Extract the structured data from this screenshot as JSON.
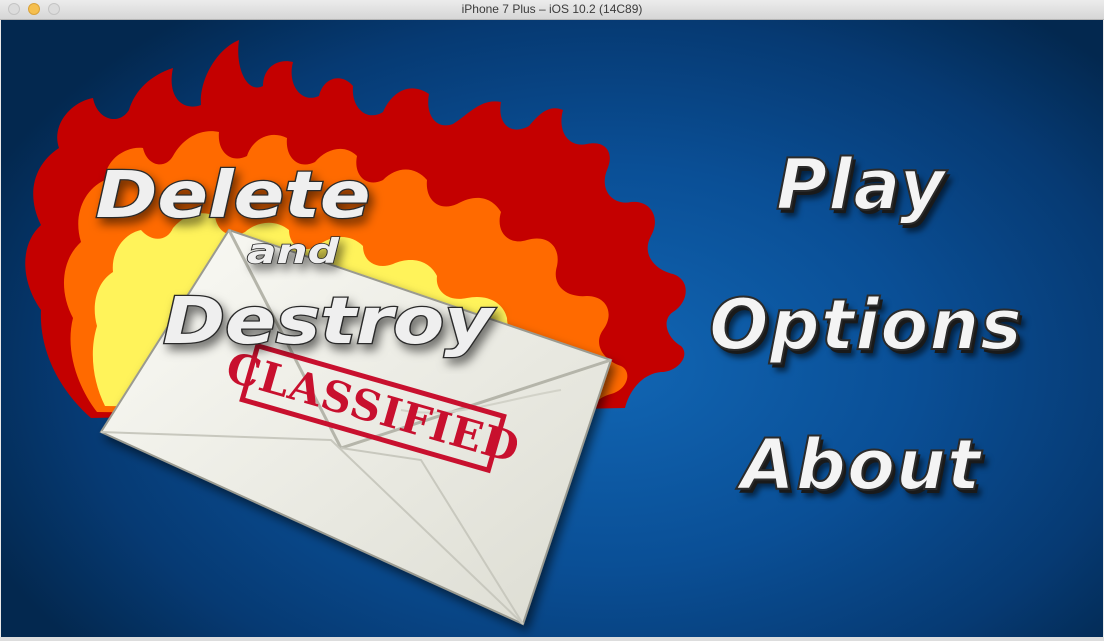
{
  "window": {
    "title": "iPhone 7 Plus – iOS 10.2 (14C89)"
  },
  "game": {
    "logo": {
      "word1": "Delete",
      "word2": "and",
      "word3": "Destroy",
      "stamp": "CLASSIFIED"
    },
    "menu": {
      "play": "Play",
      "options": "Options",
      "about": "About"
    }
  },
  "colors": {
    "background": "#0a4f96",
    "flame_outer": "#c40000",
    "flame_mid": "#ff6a00",
    "flame_inner": "#fff35a",
    "envelope": "#f2f2ea",
    "stamp": "#c8102e",
    "menu_text": "#f4f4f4"
  },
  "icons": [
    "flame-graphic",
    "envelope-graphic",
    "classified-stamp"
  ]
}
